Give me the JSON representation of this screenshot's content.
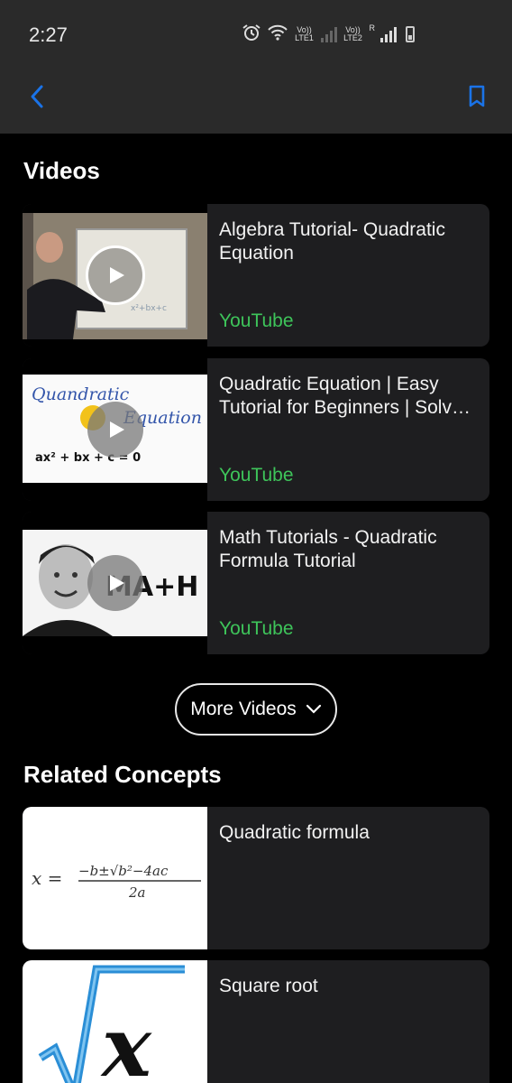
{
  "status_bar": {
    "time": "2:27",
    "sim1_label": "Vo)) LTE1",
    "sim2_label": "Vo)) LTE2",
    "roaming": "R"
  },
  "toolbar": {
    "back_icon": "chevron-left-icon",
    "bookmark_icon": "bookmark-icon",
    "accent_color": "#1a73e8"
  },
  "videos": {
    "title": "Videos",
    "items": [
      {
        "title": "Algebra Tutorial- Quadratic Equation",
        "source": "YouTube"
      },
      {
        "title": "Quadratic Equation | Easy Tutorial for Beginners | Solv…",
        "source": "YouTube",
        "thumb_text_1": "Quandratic",
        "thumb_text_2": "Equation",
        "thumb_formula": "ax² + bx + c = 0"
      },
      {
        "title": "Math Tutorials - Quadratic Formula Tutorial",
        "source": "YouTube",
        "thumb_text": "MA+H"
      }
    ],
    "more_label": "More Videos",
    "source_color": "#3ec45a"
  },
  "related": {
    "title": "Related Concepts",
    "items": [
      {
        "title": "Quadratic formula"
      },
      {
        "title": "Square root",
        "thumb_symbol": "x"
      }
    ]
  }
}
